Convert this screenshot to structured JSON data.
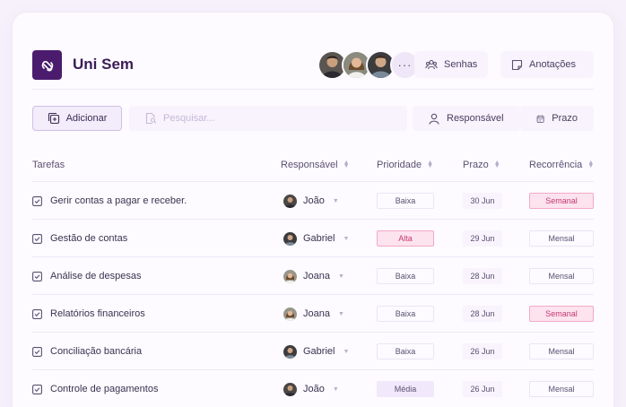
{
  "app": {
    "title": "Uni Sem"
  },
  "header": {
    "more_label": "···",
    "passwords_label": "Senhas",
    "notes_label": "Anotações"
  },
  "toolbar": {
    "add_label": "Adicionar",
    "search_placeholder": "Pesquisar...",
    "responsible_label": "Responsável",
    "deadline_label": "Prazo"
  },
  "table": {
    "headers": {
      "task": "Tarefas",
      "responsible": "Responsável",
      "priority": "Prioridade",
      "deadline": "Prazo",
      "recurrence": "Recorrência"
    },
    "rows": [
      {
        "task": "Gerir contas a pagar e receber.",
        "responsible": "João",
        "priority": "Baixa",
        "deadline": "30 Jun",
        "recurrence": "Semanal"
      },
      {
        "task": "Gestão de contas",
        "responsible": "Gabriel",
        "priority": "Alta",
        "deadline": "29 Jun",
        "recurrence": "Mensal"
      },
      {
        "task": "Análise de despesas",
        "responsible": "Joana",
        "priority": "Baixa",
        "deadline": "28 Jun",
        "recurrence": "Mensal"
      },
      {
        "task": "Relatórios financeiros",
        "responsible": "Joana",
        "priority": "Baixa",
        "deadline": "28 Jun",
        "recurrence": "Semanal"
      },
      {
        "task": "Conciliação bancária",
        "responsible": "Gabriel",
        "priority": "Baixa",
        "deadline": "26 Jun",
        "recurrence": "Mensal"
      },
      {
        "task": "Controle de pagamentos",
        "responsible": "João",
        "priority": "Média",
        "deadline": "26 Jun",
        "recurrence": "Mensal"
      }
    ]
  },
  "colors": {
    "brand": "#4b1c6e",
    "alert_pink": "#c3386e",
    "background": "#f6f1fb"
  },
  "icons": {
    "logo": "link-loop-icon",
    "passwords": "people-group-icon",
    "notes": "note-icon",
    "add": "add-copy-icon",
    "search": "file-search-icon",
    "responsible": "user-icon",
    "deadline": "calendar-icon",
    "task": "checkbox-icon"
  }
}
